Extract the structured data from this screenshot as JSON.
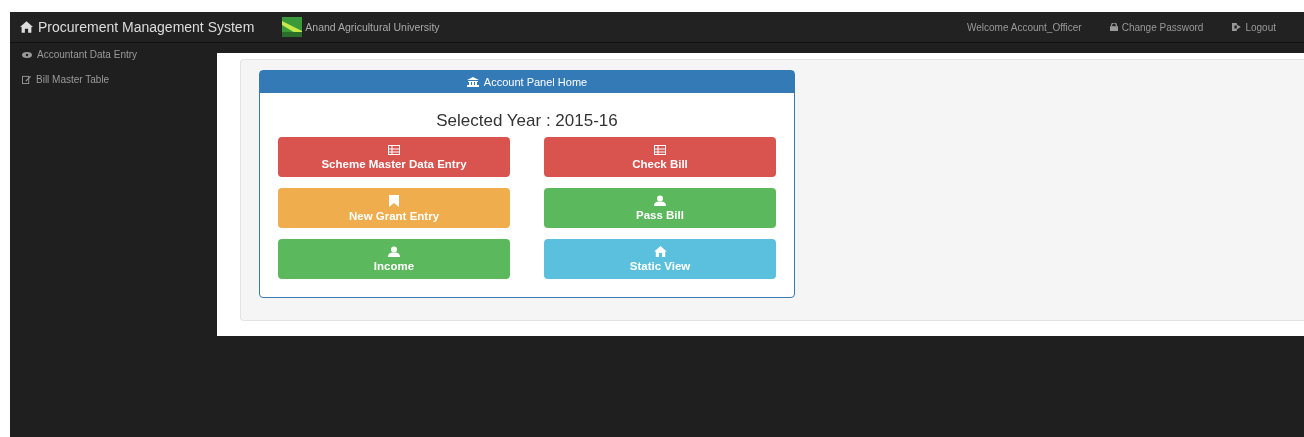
{
  "navbar": {
    "brand": "Procurement Management System",
    "university": "Anand Agricultural University",
    "welcome": "Welcome Account_Officer",
    "links": [
      "Change Password",
      "Logout"
    ]
  },
  "sidebar": {
    "items": [
      "Accountant Data Entry",
      "Bill Master Table"
    ]
  },
  "panel": {
    "title": "Account Panel Home",
    "year": "Selected Year : 2015-16",
    "buttons": [
      {
        "label": "Scheme Master Data Entry",
        "kind": "danger"
      },
      {
        "label": "Check Bill",
        "kind": "danger"
      },
      {
        "label": "New Grant Entry",
        "kind": "warning"
      },
      {
        "label": "Pass Bill",
        "kind": "success"
      },
      {
        "label": "Income",
        "kind": "success"
      },
      {
        "label": "Static View",
        "kind": "info"
      }
    ]
  }
}
